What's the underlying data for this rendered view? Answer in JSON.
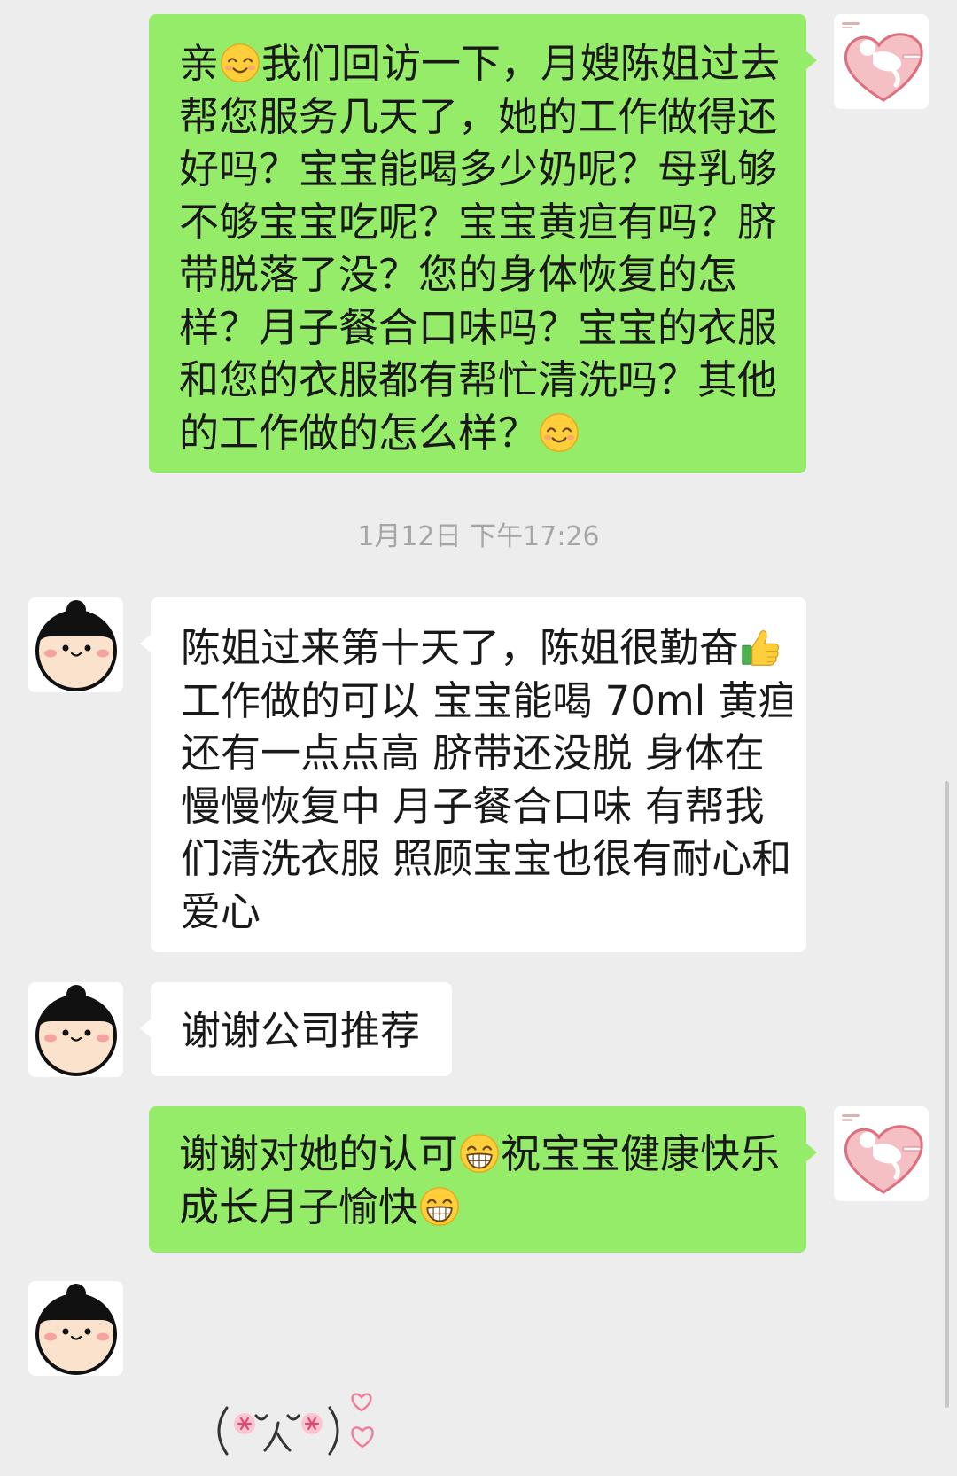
{
  "theme": {
    "background": "#ededed",
    "outgoing_bubble": "#95ec69",
    "incoming_bubble": "#ffffff",
    "message_text": "#191919",
    "timestamp_text": "#a6a6a6",
    "scrollbar": "#c7c7c7"
  },
  "messages": [
    {
      "avatar_icon": "heart-baby-logo",
      "lines": [
        [
          {
            "text": "亲"
          },
          {
            "emoji": "smiling-face"
          },
          {
            "text": "我们回访一下，月嫂陈姐过去"
          }
        ],
        [
          {
            "text": "帮您服务几天了，她的工作做得还"
          }
        ],
        [
          {
            "text": "好吗？宝宝能喝多少奶呢？母乳够"
          }
        ],
        [
          {
            "text": "不够宝宝吃呢？宝宝黄疸有吗？脐"
          }
        ],
        [
          {
            "text": "带脱落了没？您的身体恢复的怎"
          }
        ],
        [
          {
            "text": "样？月子餐合口味吗？宝宝的衣服"
          }
        ],
        [
          {
            "text": "和您的衣服都有帮忙清洗吗？其他"
          }
        ],
        [
          {
            "text": "的工作做的怎么样？"
          },
          {
            "emoji": "smiling-face"
          }
        ]
      ]
    },
    {
      "avatar_icon": "cartoon-girl",
      "lines": [
        [
          {
            "text": "陈姐过来第十天了，陈姐很勤奋"
          },
          {
            "emoji": "thumbs-up"
          }
        ],
        [
          {
            "text": "工作做的可以 宝宝能喝 70ml 黄疸"
          }
        ],
        [
          {
            "text": "还有一点点高 脐带还没脱 身体在"
          }
        ],
        [
          {
            "text": "慢慢恢复中 月子餐合口味 有帮我"
          }
        ],
        [
          {
            "text": "们清洗衣服 照顾宝宝也很有耐心和"
          }
        ],
        [
          {
            "text": "爱心"
          }
        ]
      ]
    },
    {
      "avatar_icon": "cartoon-girl",
      "lines": [
        [
          {
            "text": "谢谢公司推荐"
          }
        ]
      ]
    },
    {
      "avatar_icon": "heart-baby-logo",
      "lines": [
        [
          {
            "text": "谢谢对她的认可"
          },
          {
            "emoji": "beaming-face"
          },
          {
            "text": "祝宝宝健康快乐"
          }
        ],
        [
          {
            "text": "成长月子愉快"
          },
          {
            "emoji": "beaming-face"
          }
        ]
      ]
    },
    {
      "avatar_icon": "cartoon-girl",
      "sticker_icon": "kaomoji-hearts-sticker"
    }
  ],
  "timestamp_divider": "1月12日 下午17:26"
}
